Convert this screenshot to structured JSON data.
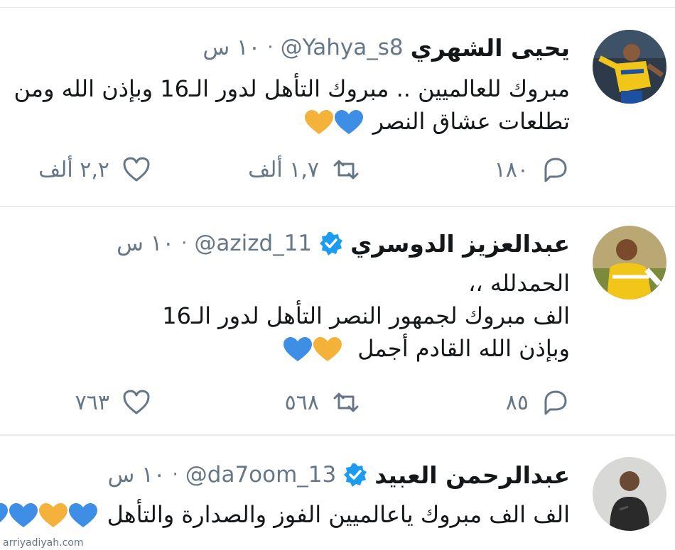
{
  "tweets": [
    {
      "name": "يحيى الشهري",
      "handle": "@Yahya_s8",
      "separator": "·",
      "time": "١٠ س",
      "lines": [
        "مبروك للعالميين .. مبروك التأهل لدور الـ16 وبإذن الله ومن",
        "تطلعات عشاق النصر"
      ],
      "emojis": [
        "blue-heart",
        "yellow-heart"
      ],
      "replies": "١٨٠",
      "retweets": "١,٧ ألف",
      "likes": "٢,٢ ألف"
    },
    {
      "name": "عبدالعزيز الدوسري",
      "verified": true,
      "handle": "@azizd_11",
      "separator": "·",
      "time": "١٠ س",
      "lines": [
        "الحمدلله ،،",
        "الف مبروك لجمهور النصر التأهل لدور الـ16",
        "وبإذن الله القادم أجمل"
      ],
      "emojis": [
        "yellow-heart",
        "blue-heart"
      ],
      "replies": "٨٥",
      "retweets": "٥٦٨",
      "likes": "٧٦٣"
    },
    {
      "name": "عبدالرحمن العبيد",
      "verified": true,
      "handle": "@da7oom_13",
      "separator": "·",
      "time": "١٠ س",
      "lines": [
        "الف الف مبروك ياعالميين الفوز والصدارة والتأهل"
      ],
      "emojis": [
        "blue-heart",
        "yellow-heart",
        "blue-heart",
        "blue-heart"
      ]
    }
  ],
  "colors": {
    "blue_heart": "#3f8ee6",
    "yellow_heart": "#f4b23a",
    "muted": "#657786",
    "verified": "#1d9bf0"
  },
  "watermark": "arriyadiyah.com"
}
